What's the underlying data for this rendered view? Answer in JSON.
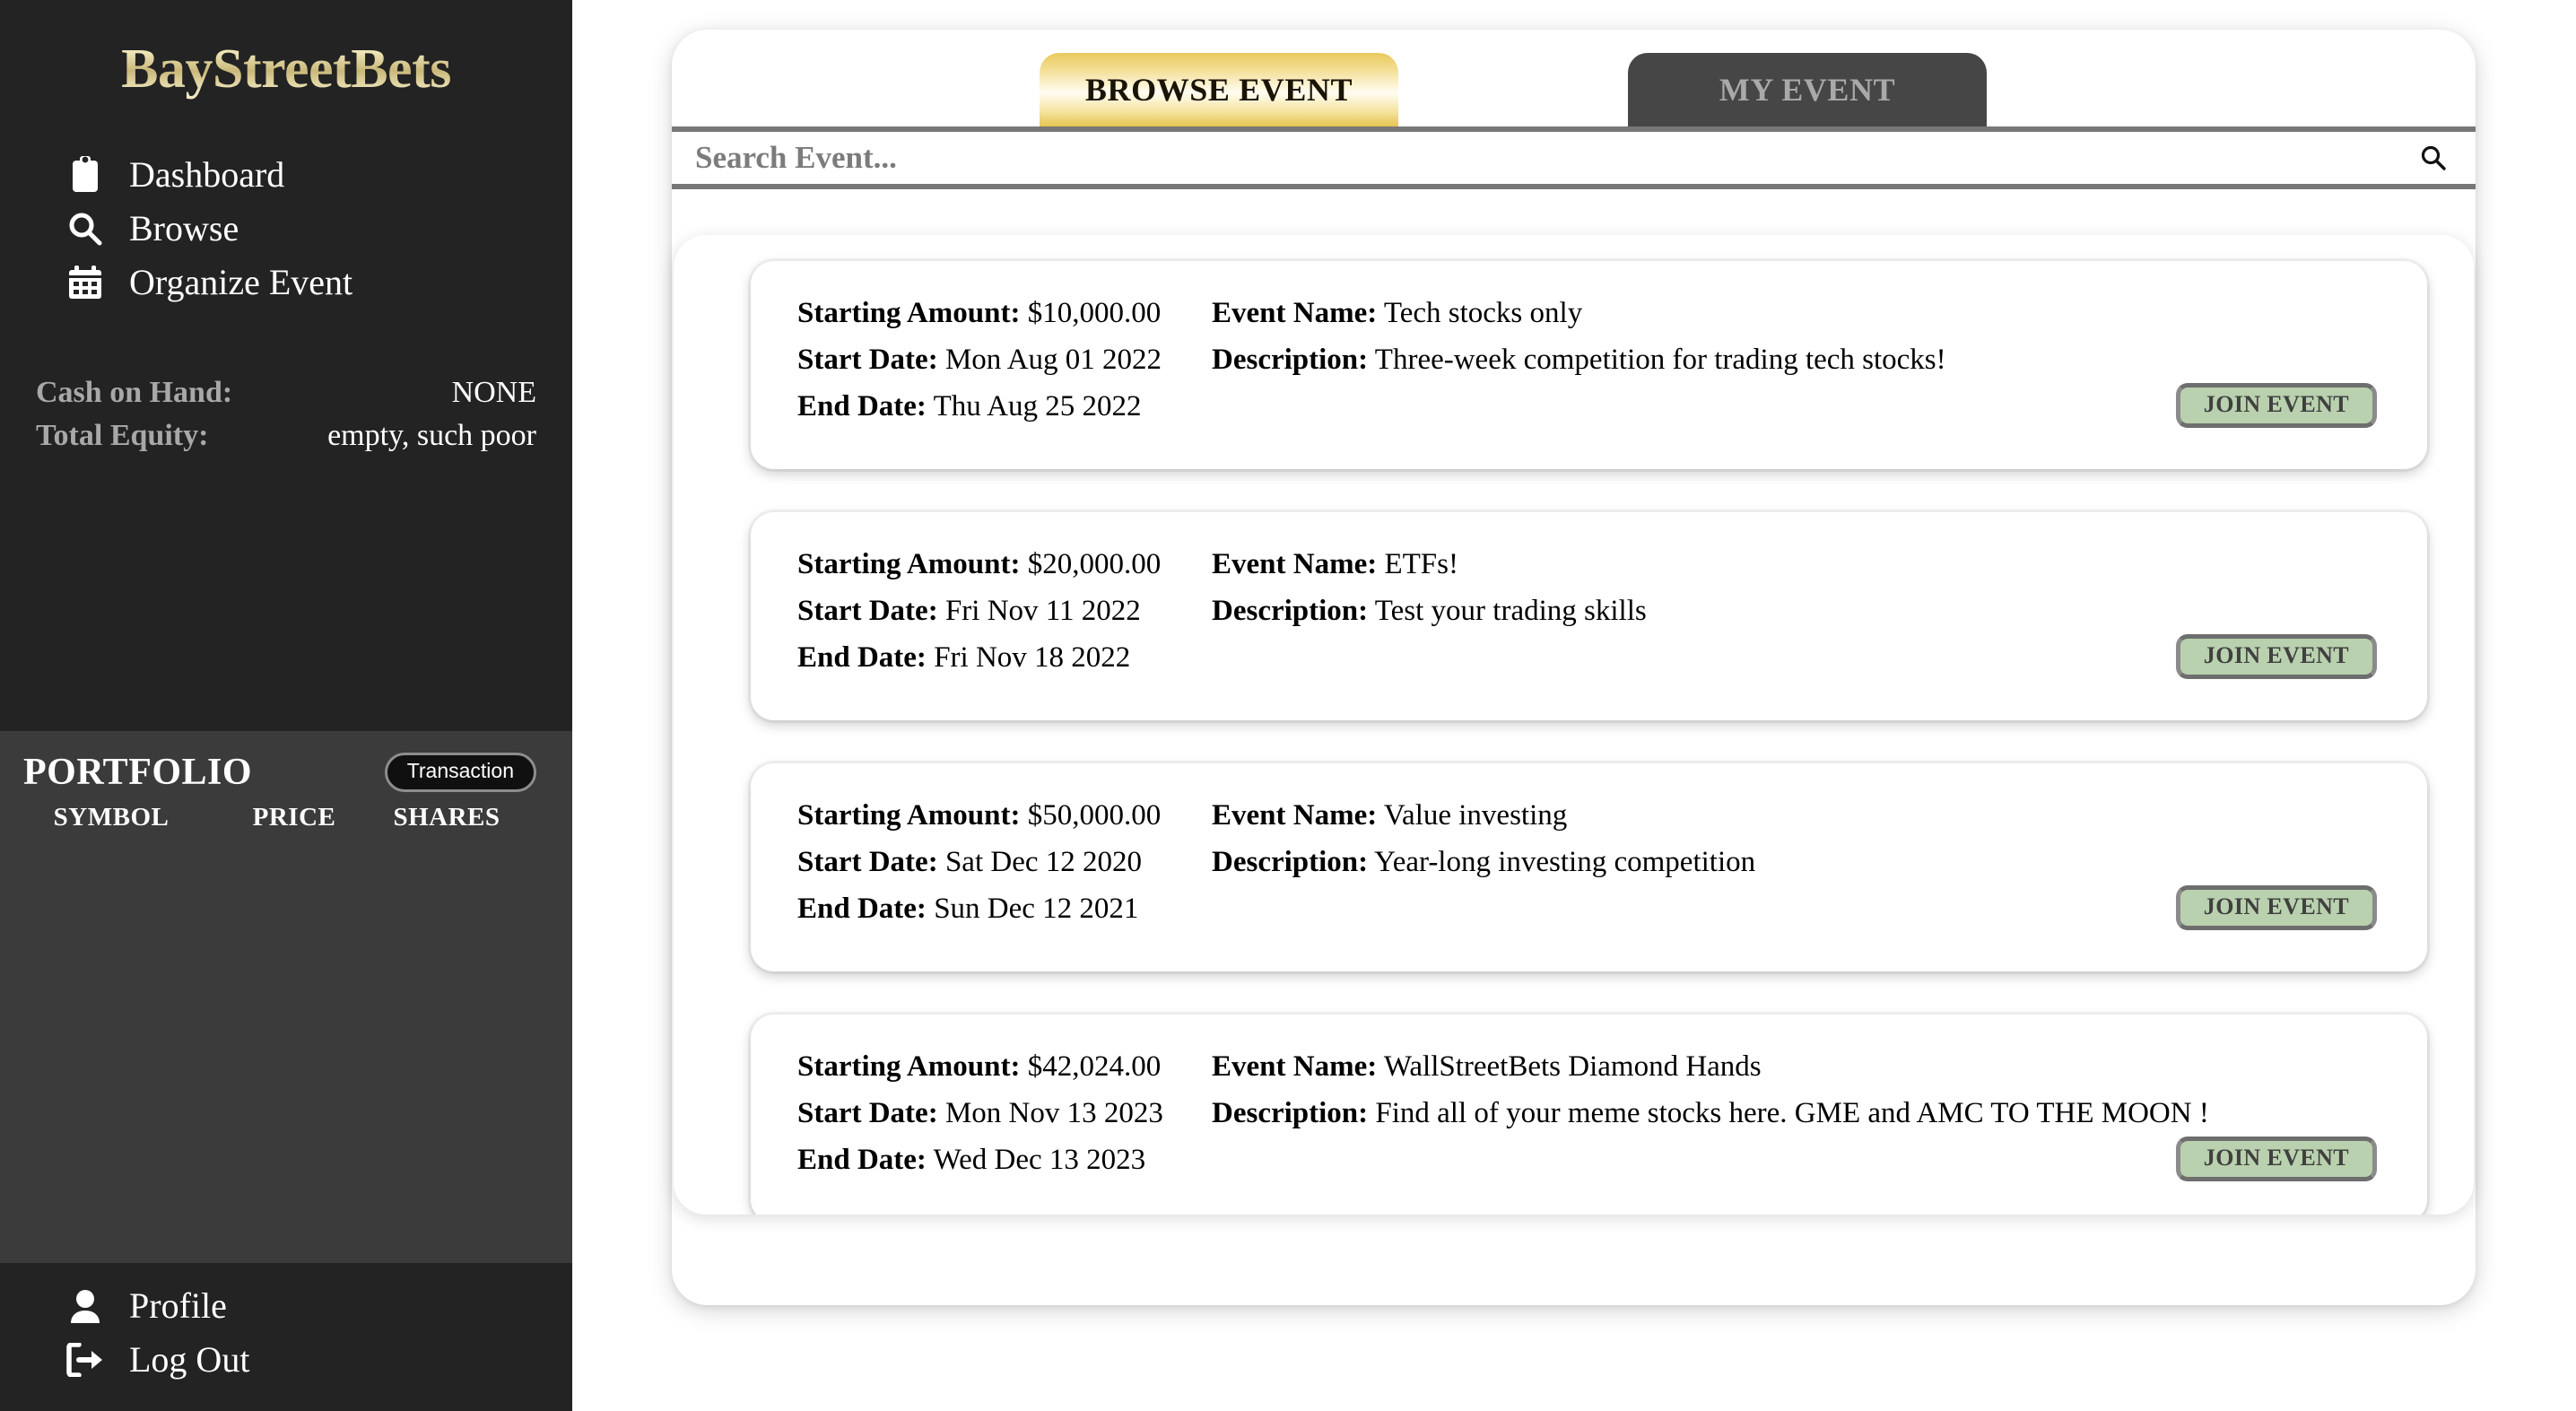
{
  "sidebar": {
    "brand": "BayStreetBets",
    "nav": [
      {
        "label": "Dashboard",
        "icon": "clipboard-icon"
      },
      {
        "label": "Browse",
        "icon": "search-icon"
      },
      {
        "label": "Organize Event",
        "icon": "calendar-icon"
      }
    ],
    "stats": [
      {
        "label": "Cash on Hand:",
        "value": "NONE"
      },
      {
        "label": "Total Equity:",
        "value": "empty, such poor"
      }
    ],
    "portfolio": {
      "title": "PORTFOLIO",
      "transaction_label": "Transaction",
      "columns": [
        "SYMBOL",
        "PRICE",
        "SHARES"
      ]
    },
    "bottom_nav": [
      {
        "label": "Profile",
        "icon": "person-icon"
      },
      {
        "label": "Log Out",
        "icon": "sign-out-icon"
      }
    ]
  },
  "main": {
    "tabs": [
      {
        "label": "BROWSE EVENT",
        "active": true
      },
      {
        "label": "MY EVENT",
        "active": false
      }
    ],
    "search": {
      "placeholder": "Search Event...",
      "value": "",
      "icon": "search-icon"
    },
    "labels": {
      "starting_amount": "Starting Amount:",
      "start_date": "Start Date:",
      "end_date": "End Date:",
      "event_name": "Event Name:",
      "description": "Description:",
      "join": "JOIN EVENT"
    },
    "events": [
      {
        "starting_amount": "$10,000.00",
        "start_date": "Mon Aug 01 2022",
        "end_date": "Thu Aug 25 2022",
        "event_name": "Tech stocks only",
        "description": "Three-week competition for trading tech stocks!"
      },
      {
        "starting_amount": "$20,000.00",
        "start_date": "Fri Nov 11 2022",
        "end_date": "Fri Nov 18 2022",
        "event_name": "ETFs!",
        "description": "Test your trading skills"
      },
      {
        "starting_amount": "$50,000.00",
        "start_date": "Sat Dec 12 2020",
        "end_date": "Sun Dec 12 2021",
        "event_name": "Value investing",
        "description": "Year-long investing competition"
      },
      {
        "starting_amount": "$42,024.00",
        "start_date": "Mon Nov 13 2023",
        "end_date": "Wed Dec 13 2023",
        "event_name": "WallStreetBets Diamond Hands",
        "description": "Find all of your meme stocks here. GME and AMC TO THE MOON !"
      }
    ]
  },
  "colors": {
    "sidebar_bg": "#232323",
    "portfolio_bg": "#3b3b3b",
    "tab_active_gold": "#e9c95d",
    "tab_inactive_gray": "#464646",
    "join_button_green": "#b9d1ae",
    "label_gray": "#a8a8a8"
  }
}
